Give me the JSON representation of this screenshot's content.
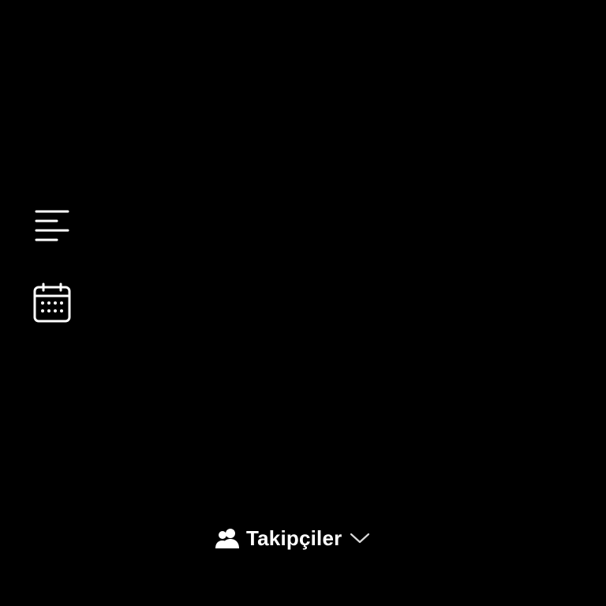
{
  "theme": {
    "background": "#000000",
    "foreground": "#ffffff",
    "chevron_color": "#d9d9d9"
  },
  "tools": [
    {
      "name": "text-align",
      "icon": "align-left-icon"
    },
    {
      "name": "date",
      "icon": "calendar-icon"
    }
  ],
  "audience": {
    "icon": "people-icon",
    "label": "Takipçiler",
    "dropdown_icon": "chevron-down-icon"
  }
}
